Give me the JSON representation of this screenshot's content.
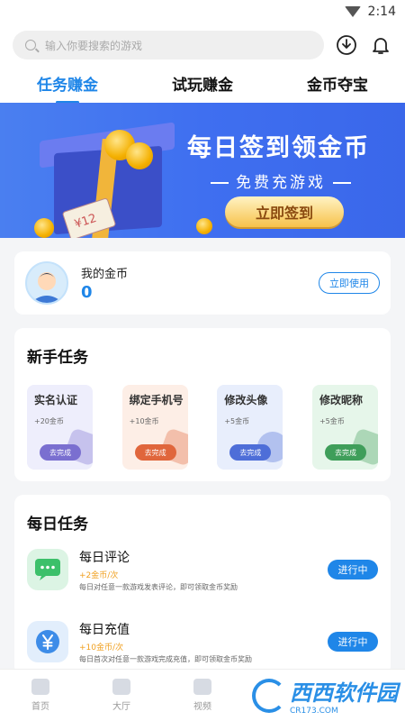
{
  "status_bar": {
    "time": "2:14"
  },
  "search": {
    "placeholder": "输入你要搜索的游戏"
  },
  "tabs": [
    {
      "label": "任务赚金",
      "active": true
    },
    {
      "label": "试玩赚金",
      "active": false
    },
    {
      "label": "金币夺宝",
      "active": false
    }
  ],
  "banner": {
    "title": "每日签到领金币",
    "subtitle": "免费充游戏",
    "button": "立即签到",
    "ticket_text": "¥12"
  },
  "coins": {
    "label": "我的金币",
    "value": "0",
    "button": "立即使用"
  },
  "newbie": {
    "title": "新手任务",
    "tasks": [
      {
        "name": "实名认证",
        "reward": "+20金币",
        "button": "去完成",
        "bg": "#eeeefc",
        "btn_color": "#7a6fd0"
      },
      {
        "name": "绑定手机号",
        "reward": "+10金币",
        "button": "去完成",
        "bg": "#fdeee6",
        "btn_color": "#e0663c"
      },
      {
        "name": "修改头像",
        "reward": "+5金币",
        "button": "去完成",
        "bg": "#e8eefc",
        "btn_color": "#4e6ed8"
      },
      {
        "name": "修改昵称",
        "reward": "+5金币",
        "button": "去完成",
        "bg": "#e6f6ea",
        "btn_color": "#3f9e5a"
      }
    ]
  },
  "daily": {
    "title": "每日任务",
    "tasks": [
      {
        "name": "每日评论",
        "reward": "+2金币/次",
        "desc": "每日对任意一款游戏发表评论，即可领取金币奖励",
        "button": "进行中",
        "icon": "comment-icon",
        "icon_bg": "#dcf4e4"
      },
      {
        "name": "每日充值",
        "reward": "+10金币/次",
        "desc": "每日首次对任意一款游戏完成充值，即可领取金币奖励",
        "button": "进行中",
        "icon": "yen-icon",
        "icon_bg": "#e2eefc"
      }
    ]
  },
  "nav": [
    {
      "label": "首页",
      "icon": "home-icon"
    },
    {
      "label": "大厅",
      "icon": "grid-icon"
    },
    {
      "label": "视频",
      "icon": "video-icon"
    }
  ],
  "watermark": {
    "text": "西西软件园",
    "sub": "CR173.COM"
  },
  "colors": {
    "accent": "#1f86e8",
    "reward": "#f0a020"
  }
}
